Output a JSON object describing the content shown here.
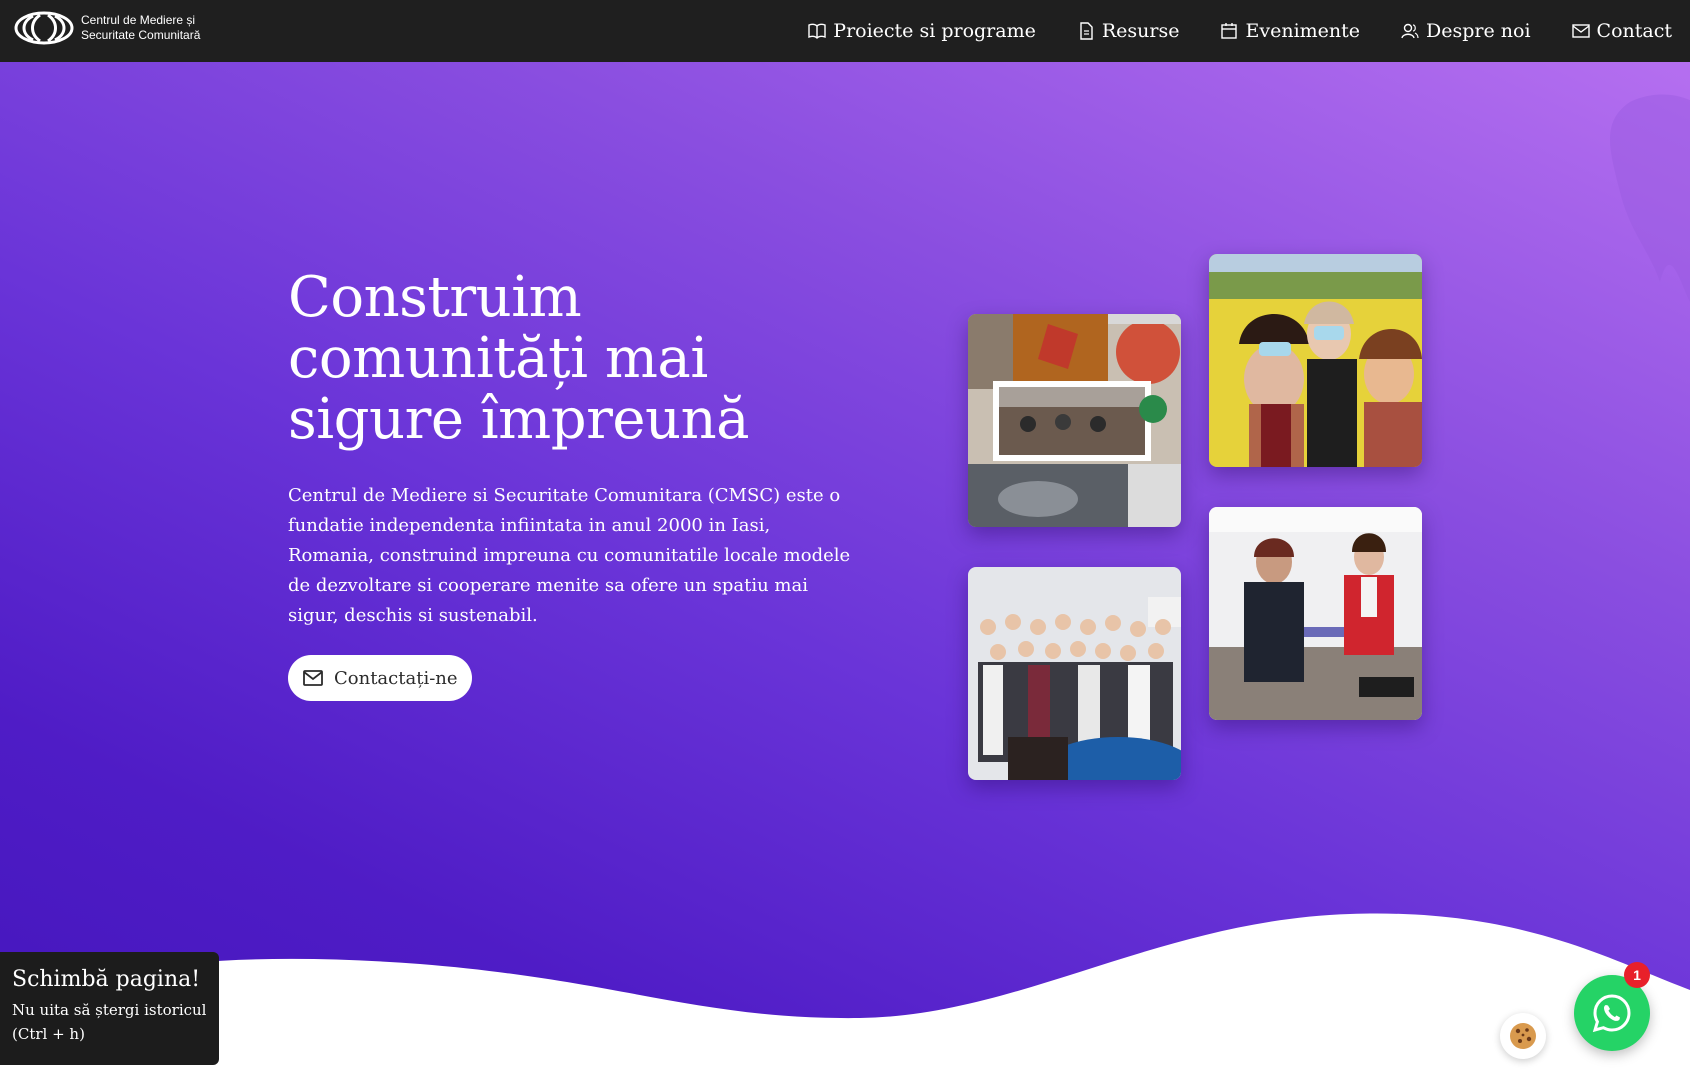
{
  "logo": {
    "line1": "Centrul de Mediere și",
    "line2": "Securitate Comunitară"
  },
  "nav": {
    "items": [
      {
        "label": "Proiecte si programe",
        "icon": "book-icon"
      },
      {
        "label": "Resurse",
        "icon": "document-icon"
      },
      {
        "label": "Evenimente",
        "icon": "calendar-icon"
      },
      {
        "label": "Despre noi",
        "icon": "people-icon"
      },
      {
        "label": "Contact",
        "icon": "envelope-icon"
      }
    ]
  },
  "hero": {
    "title_lines": [
      "Construim",
      "comunități mai",
      "sigure împreună"
    ],
    "description": "Centrul de Mediere si Securitate Comunitara (CMSC) este o fundatie independenta infiintata in anul 2000 in Iasi, Romania, construind impreuna cu comunitatile locale modele de dezvoltare si cooperare menite sa ofere un spatiu mai sigur, deschis si sustenabil.",
    "cta_label": "Contactați-ne"
  },
  "toast": {
    "title": "Schimbă pagina!",
    "line1": "Nu uita să ștergi istoricul",
    "line2": "(Ctrl + h)"
  },
  "whatsapp": {
    "badge_count": "1"
  },
  "colors": {
    "navbar": "#1f1f1f",
    "hero_gradient_top": "#b56ff0",
    "hero_gradient_bottom": "#4416bc",
    "whatsapp": "#25d366",
    "badge": "#e8202a"
  }
}
